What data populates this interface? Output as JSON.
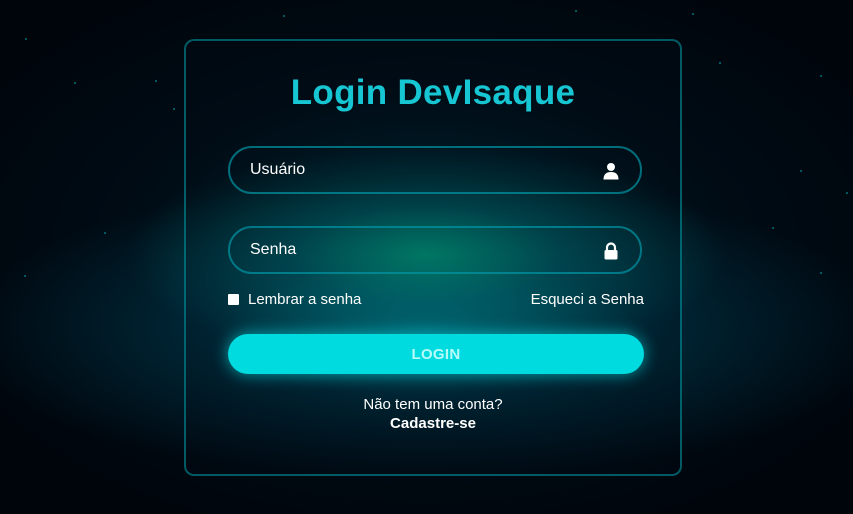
{
  "login": {
    "title": "Login DevIsaque",
    "username": {
      "placeholder": "Usuário",
      "value": "",
      "icon": "user-icon"
    },
    "password": {
      "placeholder": "Senha",
      "value": "",
      "icon": "lock-icon"
    },
    "remember_label": "Lembrar a senha",
    "remember_checked": false,
    "forgot_label": "Esqueci a Senha",
    "login_label": "LOGIN",
    "signup_prompt": "Não tem uma conta?",
    "signup_link": "Cadastre-se"
  },
  "colors": {
    "accent": "#17c6d3",
    "button": "#00dbe0",
    "background": "#00050c",
    "text": "#ffffff"
  }
}
